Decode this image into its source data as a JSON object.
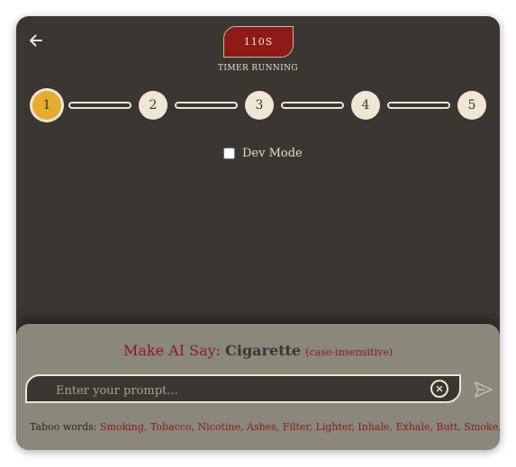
{
  "header": {
    "back_icon": "arrow-left-icon",
    "timer_value": "110S",
    "timer_status": "TIMER RUNNING"
  },
  "stepper": {
    "steps": [
      "1",
      "2",
      "3",
      "4",
      "5"
    ],
    "current_step": 1,
    "active_color": "#e6ac2e"
  },
  "dev_mode": {
    "label": "Dev Mode",
    "checked": false
  },
  "target": {
    "prefix": "Make AI Say:",
    "word": "Cigarette",
    "note": "(case-insensitive)"
  },
  "prompt": {
    "placeholder": "Enter your prompt...",
    "value": "",
    "clear_icon": "close-circle-icon",
    "send_icon": "send-icon"
  },
  "taboo": {
    "label": "Taboo words:",
    "words": "Smoking, Tobacco, Nicotine, Ashes, Filter, Lighter, Inhale, Exhale, Butt, Smoke, Cigarette"
  },
  "colors": {
    "background": "#3a3631",
    "panel": "#8a877b",
    "accent_red": "#8e1a17",
    "cream": "#efe6d3"
  }
}
